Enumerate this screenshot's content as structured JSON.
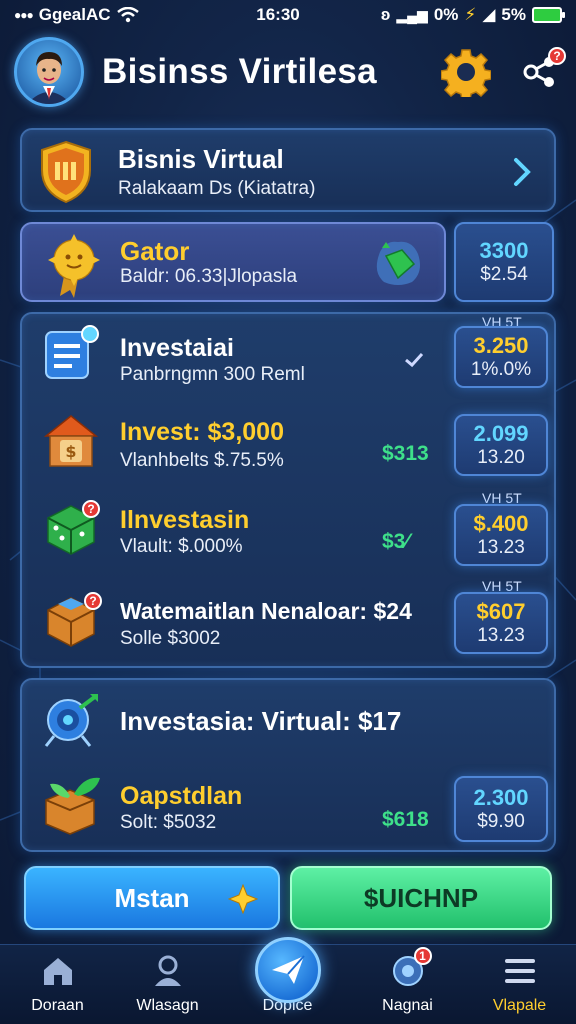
{
  "status_bar": {
    "carrier": "GgealAC",
    "time": "16:30",
    "right_text": "0% ",
    "battery": "5%"
  },
  "header": {
    "title": "Bisinss Virtilesa"
  },
  "summary_card": {
    "title": "Bisnis Virtual",
    "subtitle": "Ralakaam Ds (Kiatatra)"
  },
  "gator_card": {
    "title": "Gator",
    "subtitle": "Baldr: 06.33|Jlopasla",
    "value_top": "3300",
    "value_bottom": "$2.54",
    "value_top_color": "#62d6ff"
  },
  "investments": {
    "items": [
      {
        "title": "Investaiai",
        "subtitle": "Panbrngmn 300 Reml",
        "amount": "",
        "tag": "VH 5T",
        "value_top": "3.250",
        "value_bottom": "1%.0%",
        "value_top_color": "#ffce2e",
        "title_color": "#ffffff",
        "icon": "document-icon"
      },
      {
        "title": "Invest: $3,000",
        "subtitle": "Vlanhbelts $.75.5%",
        "amount": "$313",
        "tag": "",
        "value_top": "2.099",
        "value_bottom": "13.20",
        "value_top_color": "#62d6ff",
        "title_color": "#ffce2e",
        "icon": "house-box-icon"
      },
      {
        "title": "Ilnvestasin",
        "subtitle": "Vlault: $.000%",
        "amount": "$3⁄",
        "tag": "VH 5T",
        "value_top": "$.400",
        "value_bottom": "13.23",
        "value_top_color": "#ffce2e",
        "title_color": "#ffce2e",
        "icon": "cube-icon"
      },
      {
        "title": "Watemaitlan Nenaloar: $24",
        "subtitle": "Solle $3002",
        "amount": "",
        "tag": "VH 5T",
        "value_top": "$607",
        "value_bottom": "13.23",
        "value_top_color": "#ffce2e",
        "title_color": "#ffffff",
        "icon": "crate-icon"
      }
    ]
  },
  "virtual_card": {
    "title": "Investasia: Virtual: $17",
    "item": {
      "title": "Oapstdlan",
      "subtitle": "Solt: $5032",
      "amount": "$618",
      "value_top": "2.300",
      "value_bottom": "$9.90",
      "value_top_color": "#62d6ff"
    }
  },
  "buttons": {
    "primary": "Mstan",
    "secondary": "$UICHNP"
  },
  "bottom_nav": {
    "items": [
      {
        "label": "Doraan",
        "icon": "home-icon"
      },
      {
        "label": "Wlasagn",
        "icon": "profile-icon"
      },
      {
        "label": "Dopice",
        "icon": "plane-icon"
      },
      {
        "label": "Nagnai",
        "icon": "notification-icon"
      },
      {
        "label": "Vlapale",
        "icon": "menu-icon"
      }
    ],
    "active_label_color": "#ffce2e"
  }
}
